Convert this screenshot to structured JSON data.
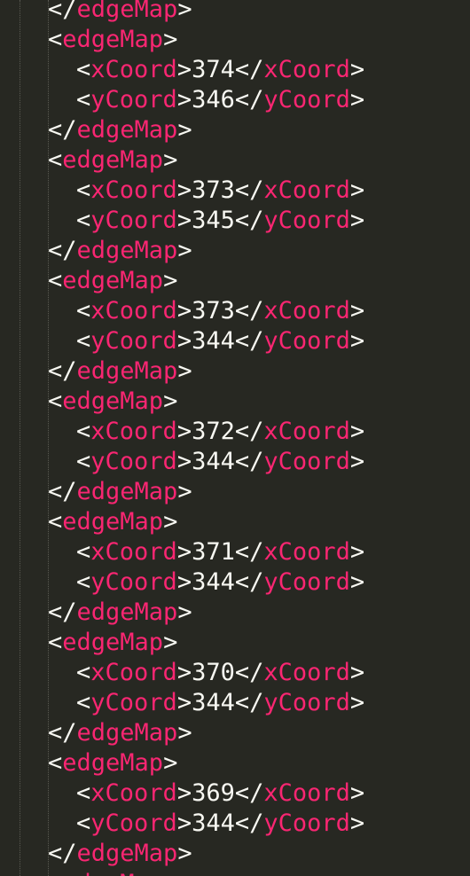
{
  "editor": {
    "theme_colors": {
      "background": "#272822",
      "tag": "#f92672",
      "text": "#f8f8f2",
      "indent_guide": "#5a5a52"
    },
    "syntax": {
      "open": "<",
      "close": ">",
      "end_open": "</"
    },
    "tags": {
      "outer": "edgeMap",
      "x": "xCoord",
      "y": "yCoord"
    },
    "blocks": [
      {
        "x": "374",
        "y": "346"
      },
      {
        "x": "373",
        "y": "345"
      },
      {
        "x": "373",
        "y": "344"
      },
      {
        "x": "372",
        "y": "344"
      },
      {
        "x": "371",
        "y": "344"
      },
      {
        "x": "370",
        "y": "344"
      },
      {
        "x": "369",
        "y": "344"
      }
    ]
  }
}
